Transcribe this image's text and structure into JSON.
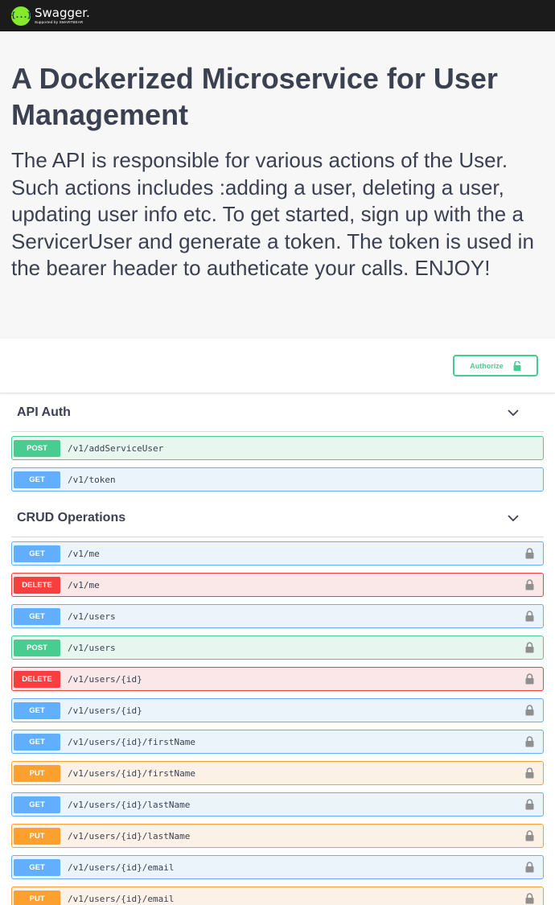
{
  "topbar": {
    "logo_name": "Swagger.",
    "logo_sub": "Supported by SMARTBEAR",
    "logo_glyph": "{...}"
  },
  "info": {
    "title": "A Dockerized Microservice for User Management",
    "description": "The API is responsible for various actions of the User. Such actions includes :adding a user, deleting a user, updating user info etc. To get started, sign up with the a ServicerUser and generate a token. The token is used in the bearer header to autheticate your calls. ENJOY!"
  },
  "authorize": {
    "label": "Authorize"
  },
  "colors": {
    "get": "#61affe",
    "post": "#49cc90",
    "delete": "#f93e3e",
    "put": "#fca130"
  },
  "groups": [
    {
      "name": "API Auth",
      "operations": [
        {
          "method": "POST",
          "path": "/v1/addServiceUser",
          "locked": false
        },
        {
          "method": "GET",
          "path": "/v1/token",
          "locked": false
        }
      ]
    },
    {
      "name": "CRUD Operations",
      "operations": [
        {
          "method": "GET",
          "path": "/v1/me",
          "locked": true
        },
        {
          "method": "DELETE",
          "path": "/v1/me",
          "locked": true
        },
        {
          "method": "GET",
          "path": "/v1/users",
          "locked": true
        },
        {
          "method": "POST",
          "path": "/v1/users",
          "locked": true
        },
        {
          "method": "DELETE",
          "path": "/v1/users/{id}",
          "locked": true
        },
        {
          "method": "GET",
          "path": "/v1/users/{id}",
          "locked": true
        },
        {
          "method": "GET",
          "path": "/v1/users/{id}/firstName",
          "locked": true
        },
        {
          "method": "PUT",
          "path": "/v1/users/{id}/firstName",
          "locked": true
        },
        {
          "method": "GET",
          "path": "/v1/users/{id}/lastName",
          "locked": true
        },
        {
          "method": "PUT",
          "path": "/v1/users/{id}/lastName",
          "locked": true
        },
        {
          "method": "GET",
          "path": "/v1/users/{id}/email",
          "locked": true
        },
        {
          "method": "PUT",
          "path": "/v1/users/{id}/email",
          "locked": true
        }
      ]
    }
  ]
}
